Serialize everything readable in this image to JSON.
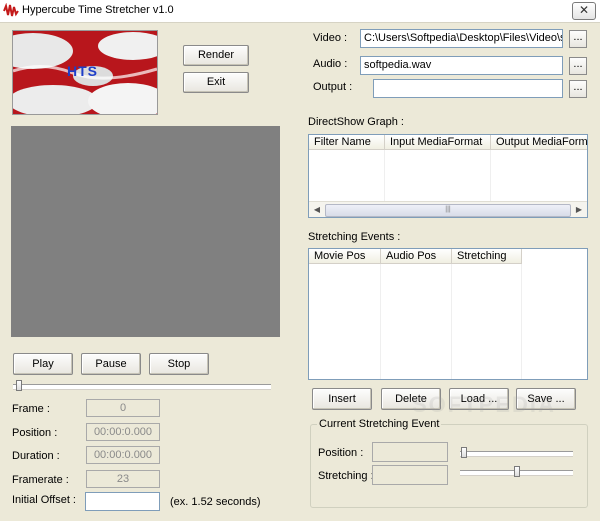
{
  "window": {
    "title": "Hypercube Time Stretcher v1.0",
    "close_glyph": "✕"
  },
  "logo": {
    "text": "HTS"
  },
  "buttons": {
    "render": "Render",
    "exit": "Exit",
    "play": "Play",
    "pause": "Pause",
    "stop": "Stop",
    "insert": "Insert",
    "delete": "Delete",
    "load": "Load ...",
    "save": "Save ..."
  },
  "files": {
    "video_label": "Video :",
    "video_value": "C:\\Users\\Softpedia\\Desktop\\Files\\Video\\softp",
    "audio_label": "Audio :",
    "audio_value": "softpedia.wav",
    "output_label": "Output :",
    "output_value": "",
    "browse": "..."
  },
  "graph": {
    "label": "DirectShow Graph :",
    "columns": [
      "Filter Name",
      "Input MediaFormat",
      "Output MediaForma"
    ]
  },
  "events": {
    "label": "Stretching Events :",
    "columns": [
      "Movie Pos",
      "Audio Pos",
      "Stretching"
    ]
  },
  "info": {
    "frame_label": "Frame :",
    "frame_value": "0",
    "position_label": "Position :",
    "position_value": "00:00:0.000",
    "duration_label": "Duration :",
    "duration_value": "00:00:0.000",
    "framerate_label": "Framerate :",
    "framerate_value": "23",
    "offset_label": "Initial Offset :",
    "offset_value": "",
    "offset_hint": "(ex. 1.52 seconds)"
  },
  "current": {
    "title": "Current Stretching Event",
    "position_label": "Position :",
    "position_value": "",
    "stretching_label": "Stretching :",
    "stretching_value": ""
  },
  "sliders": {
    "seek": 0.0,
    "position": 0.0,
    "stretching": 0.5
  },
  "colors": {
    "accent_red": "#d6181e",
    "logo_blue": "#1e3ec8",
    "video_bg": "#808080"
  }
}
